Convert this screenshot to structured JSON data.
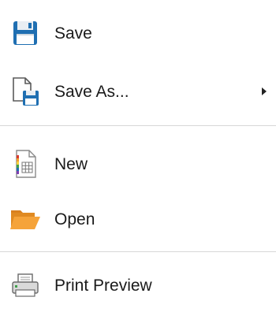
{
  "menu": {
    "items": [
      {
        "label": "Save",
        "icon": "floppy-disk-icon"
      },
      {
        "label": "Save As...",
        "icon": "save-as-icon",
        "has_submenu": true
      },
      {
        "label": "New",
        "icon": "new-spreadsheet-icon"
      },
      {
        "label": "Open",
        "icon": "folder-open-icon"
      },
      {
        "label": "Print Preview",
        "icon": "printer-icon"
      }
    ]
  },
  "colors": {
    "floppy_blue": "#1f6fb2",
    "folder_orange": "#f39c2b",
    "separator": "#d7d7d7"
  }
}
